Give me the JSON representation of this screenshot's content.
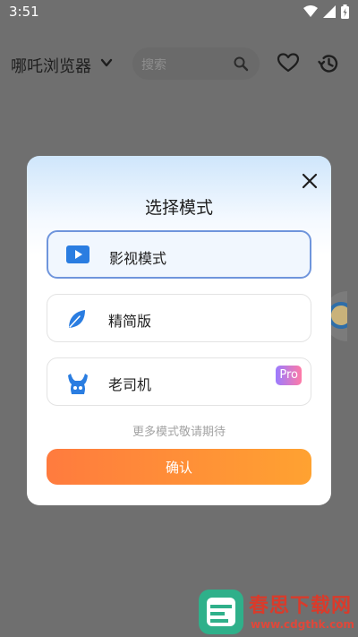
{
  "status_bar": {
    "time": "3:51"
  },
  "app_bar": {
    "title": "哪吒浏览器",
    "search_placeholder": "搜索"
  },
  "modal": {
    "title": "选择模式",
    "options": [
      {
        "label": "影视模式",
        "icon": "play-icon",
        "selected": true
      },
      {
        "label": "精简版",
        "icon": "leaf-icon",
        "selected": false
      },
      {
        "label": "老司机",
        "icon": "figure-icon",
        "selected": false,
        "badge": "Pro"
      }
    ],
    "more_text": "更多模式敬请期待",
    "confirm_label": "确认"
  },
  "watermark": {
    "name": "春思下载网",
    "url": "www.cdgthk.com"
  },
  "colors": {
    "accent_blue": "#2a7de1",
    "selected_border": "#6f95dc",
    "confirm_start": "#ff7b3e",
    "confirm_end": "#ffa231",
    "pro_start": "#9b7bff",
    "pro_end": "#ff7aa6"
  }
}
